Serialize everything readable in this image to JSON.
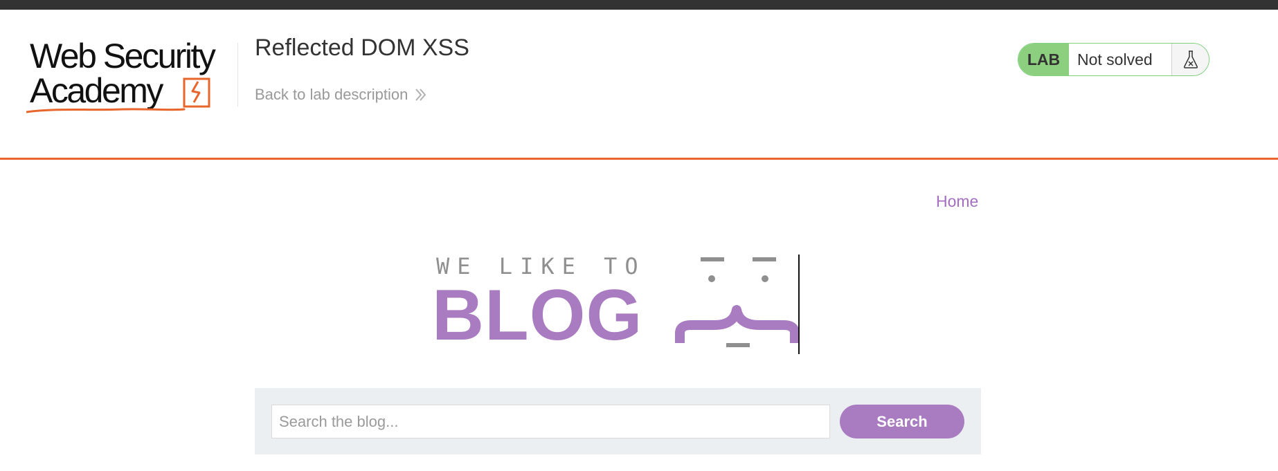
{
  "header": {
    "logo": {
      "line1": "Web Security",
      "line2": "Academy"
    },
    "lab_title": "Reflected DOM XSS",
    "back_link": "Back to lab description",
    "status": {
      "badge": "LAB",
      "text": "Not solved",
      "icon": "flask-icon"
    }
  },
  "nav": {
    "home": "Home"
  },
  "banner": {
    "tagline": "WE LIKE TO",
    "word": "BLOG"
  },
  "search": {
    "placeholder": "Search the blog...",
    "value": "",
    "button": "Search"
  },
  "colors": {
    "accent": "#a97bc0",
    "brand_orange": "#e8652b",
    "lab_green": "#8ccf7e",
    "top_bar": "#333333"
  }
}
